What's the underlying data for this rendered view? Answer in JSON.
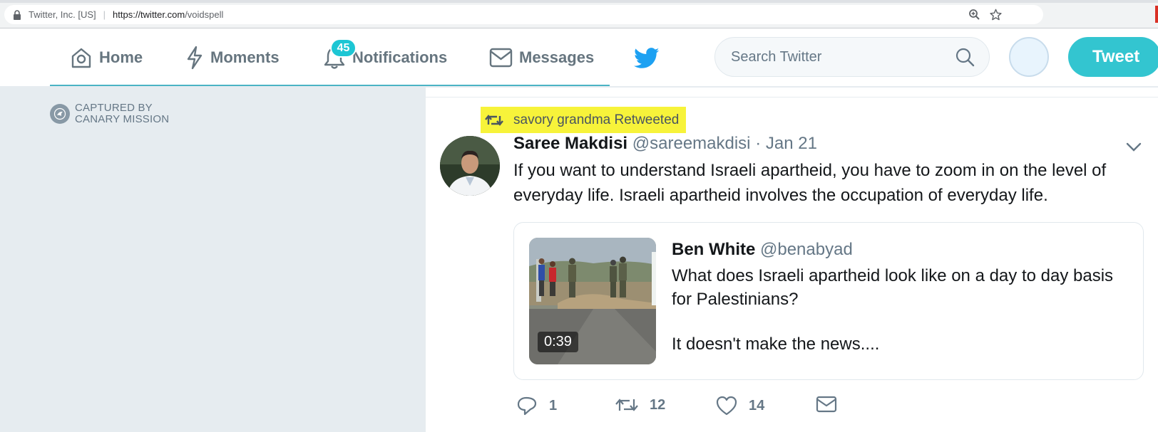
{
  "browser": {
    "site_identity": "Twitter, Inc. [US]",
    "url_host": "https://twitter.com",
    "url_path": "/voidspell"
  },
  "nav": {
    "home_label": "Home",
    "moments_label": "Moments",
    "notifications_label": "Notifications",
    "notifications_count": "45",
    "messages_label": "Messages",
    "search_placeholder": "Search Twitter",
    "tweet_button": "Tweet"
  },
  "sidebar": {
    "captured_line1": "CAPTURED BY",
    "captured_line2": "CANARY MISSION"
  },
  "tweet": {
    "retweet_context": "savory grandma Retweeted",
    "author_name": "Saree Makdisi",
    "author_handle": "@sareemakdisi",
    "separator": "·",
    "date": "Jan 21",
    "text": "If you want to understand Israeli apartheid, you have to zoom in on the level of everyday life. Israeli apartheid involves the occupation of everyday life.",
    "quoted": {
      "author_name": "Ben White",
      "author_handle": "@benabyad",
      "text_line1": "What does Israeli apartheid look like on a day to day basis for Palestinians?",
      "text_line2": "It doesn't make the news....",
      "video_duration": "0:39"
    },
    "actions": {
      "replies": "1",
      "retweets": "12",
      "likes": "14"
    }
  },
  "colors": {
    "accent": "#1da1f2",
    "tweet_button": "#33c5d0",
    "badge": "#1dc6d4",
    "highlight": "#f7f33a",
    "muted": "#657786"
  }
}
